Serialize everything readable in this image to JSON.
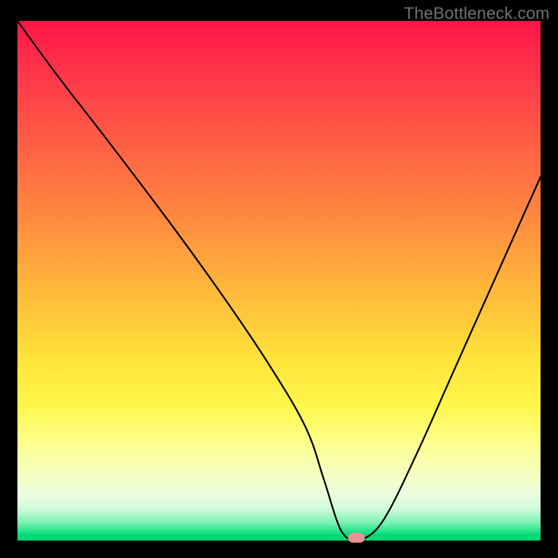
{
  "watermark": "TheBottleneck.com",
  "chart_data": {
    "type": "line",
    "title": "",
    "xlabel": "",
    "ylabel": "",
    "xlim": [
      0,
      100
    ],
    "ylim": [
      0,
      100
    ],
    "series": [
      {
        "name": "bottleneck-curve",
        "x": [
          0,
          8,
          18,
          30,
          40,
          48,
          55,
          58.5,
          61,
          62.5,
          64,
          66,
          70,
          76,
          84,
          92,
          100
        ],
        "values": [
          100,
          89,
          76,
          60,
          46,
          34,
          22,
          12,
          4,
          1,
          0.2,
          0.2,
          4,
          16,
          34,
          52,
          70
        ]
      }
    ],
    "marker": {
      "x": 64.8,
      "y": 0.5
    },
    "colors": {
      "curve": "#000000",
      "marker": "#e79593",
      "gradient_top": "#ff1646",
      "gradient_bottom": "#00d876"
    }
  }
}
